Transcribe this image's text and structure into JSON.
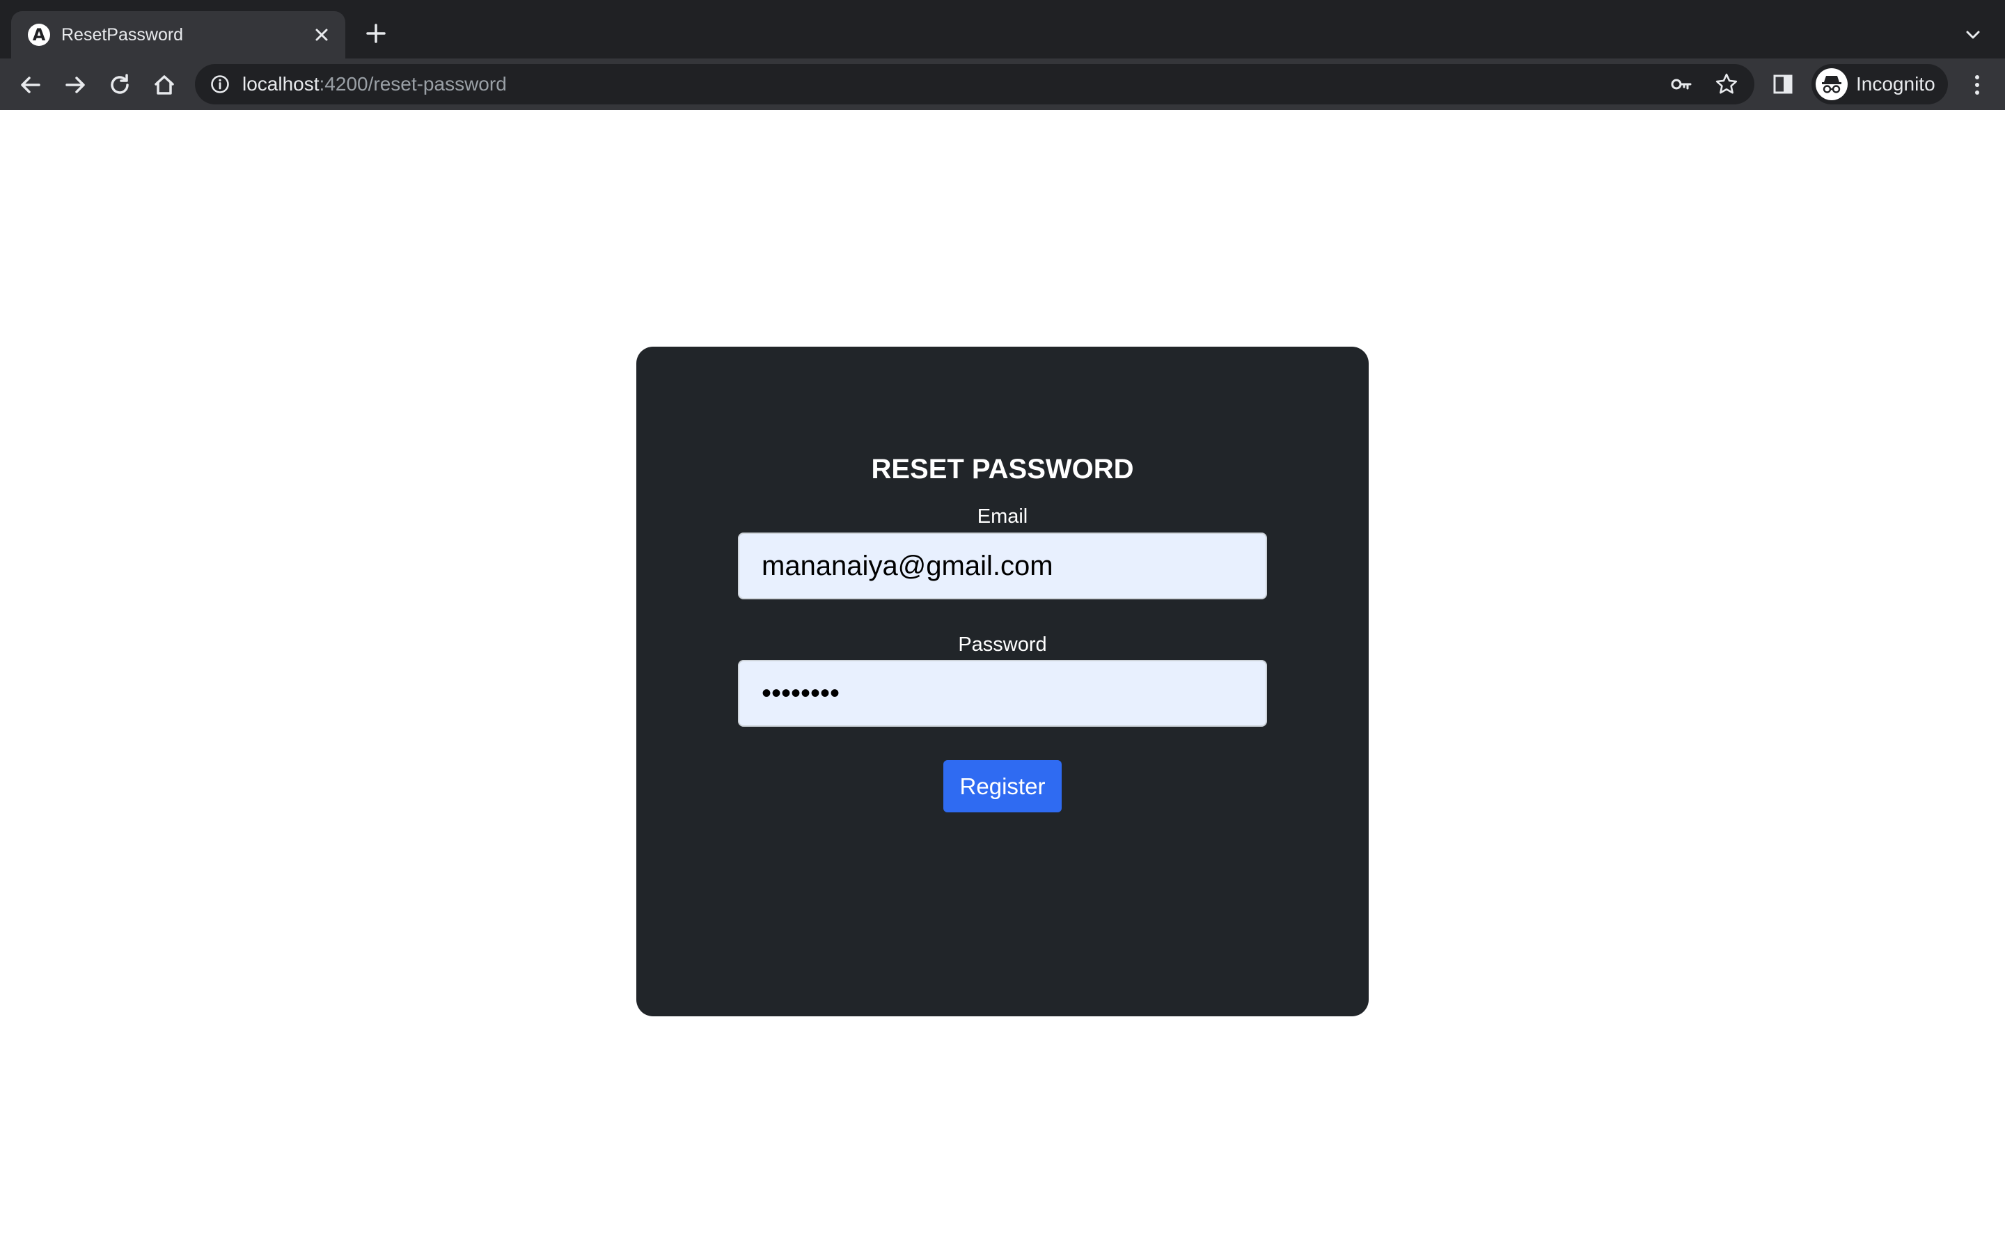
{
  "browser": {
    "tab": {
      "title": "ResetPassword",
      "favicon_letter": "A"
    },
    "address_bar": {
      "host": "localhost",
      "path": ":4200/reset-password"
    },
    "profile": {
      "label": "Incognito"
    },
    "icons": {
      "back": "arrow-left-icon",
      "forward": "arrow-right-icon",
      "reload": "reload-icon",
      "home": "home-icon",
      "site_info": "info-icon",
      "password_key": "key-icon",
      "bookmark": "star-icon",
      "side_panel": "side-panel-icon",
      "menu": "three-dots-vertical-icon",
      "tab_search": "chevron-down-icon"
    }
  },
  "form": {
    "title": "RESET PASSWORD",
    "email": {
      "label": "Email",
      "value": "mananaiya@gmail.com"
    },
    "password": {
      "label": "Password",
      "value": "••••••••"
    },
    "submit_label": "Register"
  },
  "colors": {
    "card_background": "#212529",
    "input_background": "#e8f0fe",
    "button_primary": "#2f6bf2",
    "browser_frame": "#202124",
    "browser_toolbar": "#35363a"
  }
}
